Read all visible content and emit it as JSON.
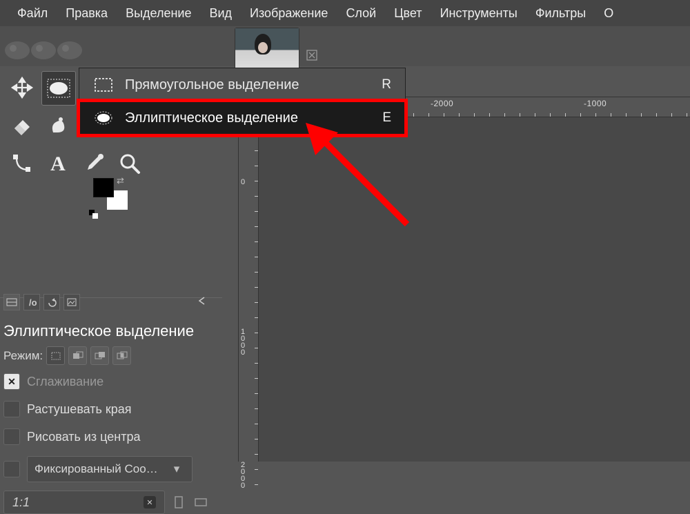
{
  "menubar": {
    "items": [
      "Файл",
      "Правка",
      "Выделение",
      "Вид",
      "Изображение",
      "Слой",
      "Цвет",
      "Инструменты",
      "Фильтры",
      "О"
    ]
  },
  "flyout": {
    "rect": {
      "label": "Прямоугольное выделение",
      "key": "R"
    },
    "ellipse": {
      "label": "Эллиптическое выделение",
      "key": "E"
    }
  },
  "tool_options": {
    "title": "Эллиптическое выделение",
    "mode_label": "Режим:",
    "antialias": "Сглаживание",
    "feather": "Растушевать края",
    "from_center": "Рисовать из центра",
    "fixed": "Фиксированный Соо…",
    "ratio": "1:1"
  },
  "ruler": {
    "h": [
      "-2000",
      "-1000"
    ],
    "v": [
      "0",
      "1000",
      "2000"
    ]
  },
  "chart_data": null
}
